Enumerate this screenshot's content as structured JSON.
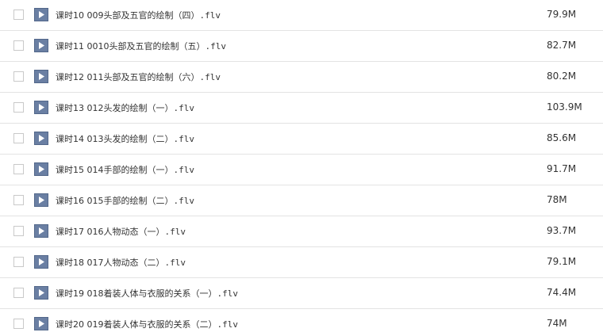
{
  "files": [
    {
      "lesson": "课时10",
      "name": "009头部及五官的绘制（四）",
      "ext": ".flv",
      "size": "79.9M"
    },
    {
      "lesson": "课时11",
      "name": "0010头部及五官的绘制（五）",
      "ext": ".flv",
      "size": "82.7M"
    },
    {
      "lesson": "课时12",
      "name": "011头部及五官的绘制（六）",
      "ext": ".flv",
      "size": "80.2M"
    },
    {
      "lesson": "课时13",
      "name": "012头发的绘制（一）",
      "ext": ".flv",
      "size": "103.9M"
    },
    {
      "lesson": "课时14",
      "name": "013头发的绘制（二）",
      "ext": ".flv",
      "size": "85.6M"
    },
    {
      "lesson": "课时15",
      "name": "014手部的绘制（一）",
      "ext": ".flv",
      "size": "91.7M"
    },
    {
      "lesson": "课时16",
      "name": "015手部的绘制（二）",
      "ext": ".flv",
      "size": "78M"
    },
    {
      "lesson": "课时17",
      "name": "016人物动态（一）",
      "ext": ".flv",
      "size": "93.7M"
    },
    {
      "lesson": "课时18",
      "name": "017人物动态（二）",
      "ext": ".flv",
      "size": "79.1M"
    },
    {
      "lesson": "课时19",
      "name": "018着装人体与衣服的关系（一）",
      "ext": ".flv",
      "size": "74.4M"
    },
    {
      "lesson": "课时20",
      "name": "019着装人体与衣服的关系（二）",
      "ext": ".flv",
      "size": "74M"
    }
  ],
  "icons": {
    "file_type": "video-file-icon"
  },
  "colors": {
    "icon_bg": "#52678a",
    "row_border": "#e3e3e3",
    "text": "#333333"
  }
}
